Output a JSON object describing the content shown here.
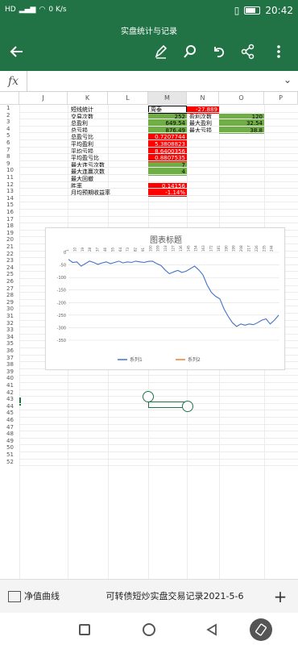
{
  "status": {
    "signal_text": "HD",
    "speed_value": "0",
    "speed_unit": "K/s",
    "battery_level": 0.6,
    "time": "20:42"
  },
  "app_bar": {
    "title": "实盘统计与记录",
    "icons": [
      "back-arrow-icon",
      "pen-icon",
      "search-icon",
      "undo-icon",
      "share-icon",
      "more-icon"
    ]
  },
  "formula": {
    "fx_label": "fx",
    "value": ""
  },
  "columns": [
    "J",
    "K",
    "L",
    "M",
    "N",
    "O",
    "P"
  ],
  "rows": [
    "1",
    "2",
    "3",
    "4",
    "5",
    "6",
    "7",
    "8",
    "9",
    "10",
    "11",
    "12",
    "13",
    "14",
    "15",
    "16",
    "17",
    "18",
    "19",
    "20",
    "21",
    "22",
    "23",
    "24",
    "25",
    "26",
    "27",
    "28",
    "29",
    "30",
    "31",
    "32",
    "33",
    "34",
    "35",
    "36",
    "37",
    "38",
    "39",
    "40",
    "41",
    "42",
    "43",
    "44",
    "45",
    "46",
    "47",
    "48",
    "49",
    "50",
    "51",
    "52"
  ],
  "table": {
    "k": [
      "短线统计",
      "交易次数",
      "总盈利",
      "总亏损",
      "总盈亏比",
      "平均盈利",
      "平均亏损",
      "平均盈亏比",
      "最大连亏次数",
      "最大连赢次数",
      "最大回撤",
      "胜率",
      "月均预期收益率"
    ],
    "m": [
      "周泰",
      "252",
      "649.54",
      "876.49",
      "0.7207744",
      "5.3808823",
      "8.6400356",
      "0.8807535",
      "7",
      "4",
      "",
      "0.14156",
      "-1.14%"
    ],
    "n_header": "-27.889",
    "n": [
      "盈利次数",
      "最大盈利",
      "最大亏损"
    ],
    "o": [
      "120",
      "32.54",
      "38.8"
    ]
  },
  "chart_data": {
    "type": "line",
    "title": "图表标题",
    "ylim": [
      -350,
      0
    ],
    "yticks": [
      0,
      -50,
      -100,
      -150,
      -200,
      -250,
      -300,
      -350
    ],
    "xticks": [
      "1",
      "10",
      "19",
      "28",
      "37",
      "46",
      "55",
      "64",
      "73",
      "82",
      "91",
      "100",
      "109",
      "118",
      "127",
      "136",
      "145",
      "154",
      "163",
      "172",
      "181",
      "190",
      "199",
      "208",
      "217",
      "226",
      "235",
      "244"
    ],
    "series": [
      {
        "name": "系列1",
        "color": "#4472c4",
        "x": [
          1,
          6,
          11,
          16,
          21,
          26,
          31,
          36,
          41,
          46,
          51,
          56,
          61,
          66,
          71,
          76,
          81,
          86,
          91,
          96,
          101,
          106,
          111,
          116,
          121,
          126,
          131,
          136,
          141,
          146,
          151,
          156,
          161,
          166,
          171,
          176,
          181,
          186,
          191,
          196,
          201,
          206,
          211,
          216,
          221,
          226,
          231,
          236,
          241,
          246,
          251
        ],
        "values": [
          -28,
          -40,
          -38,
          -55,
          -45,
          -35,
          -40,
          -48,
          -42,
          -38,
          -45,
          -40,
          -35,
          -42,
          -38,
          -40,
          -35,
          -38,
          -40,
          -36,
          -35,
          -45,
          -52,
          -70,
          -85,
          -78,
          -72,
          -80,
          -75,
          -65,
          -55,
          -70,
          -90,
          -130,
          -160,
          -175,
          -185,
          -225,
          -255,
          -280,
          -295,
          -285,
          -290,
          -285,
          -288,
          -280,
          -270,
          -265,
          -285,
          -270,
          -250
        ]
      },
      {
        "name": "系列2",
        "color": "#ed7d31",
        "x": [],
        "values": []
      }
    ]
  },
  "tabs": {
    "active": "净值曲线",
    "second": "可转债短炒实盘交易记录2021-5-6",
    "add": "+"
  },
  "nav": [
    "square-icon",
    "home-circle-icon",
    "back-triangle-icon",
    "rotate-icon"
  ]
}
